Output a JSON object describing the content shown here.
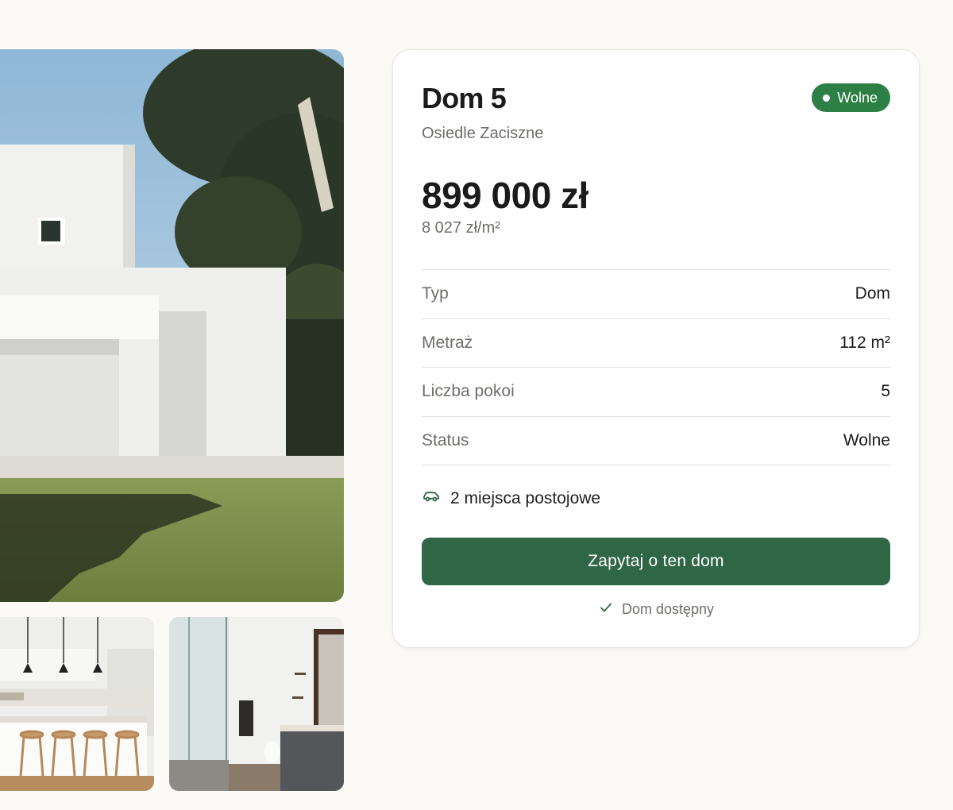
{
  "gallery": {
    "main_image": "white-modern-house-with-pine-tree-photo",
    "thumbnails": [
      "kitchen-with-pendant-lamps-photo",
      "bathroom-with-glass-shower-photo"
    ]
  },
  "listing": {
    "title": "Dom 5",
    "subtitle": "Osiedle Zaciszne",
    "badge": "Wolne",
    "price": "899 000 zł",
    "price_per_sqm": "8 027 zł/m²",
    "specs": [
      {
        "label": "Typ",
        "value": "Dom"
      },
      {
        "label": "Metraż",
        "value": "112 m²"
      },
      {
        "label": "Liczba pokoi",
        "value": "5"
      },
      {
        "label": "Status",
        "value": "Wolne"
      }
    ],
    "parking": {
      "icon": "car-icon",
      "text": "2 miejsca postojowe"
    },
    "cta_label": "Zapytaj o ten dom",
    "availability": {
      "icon": "check-icon",
      "text": "Dom dostępny"
    }
  },
  "colors": {
    "background": "#fbfaf6",
    "accent_green": "#2f6645",
    "badge_green": "#2c7f45",
    "muted_text": "#6d6d6a"
  }
}
